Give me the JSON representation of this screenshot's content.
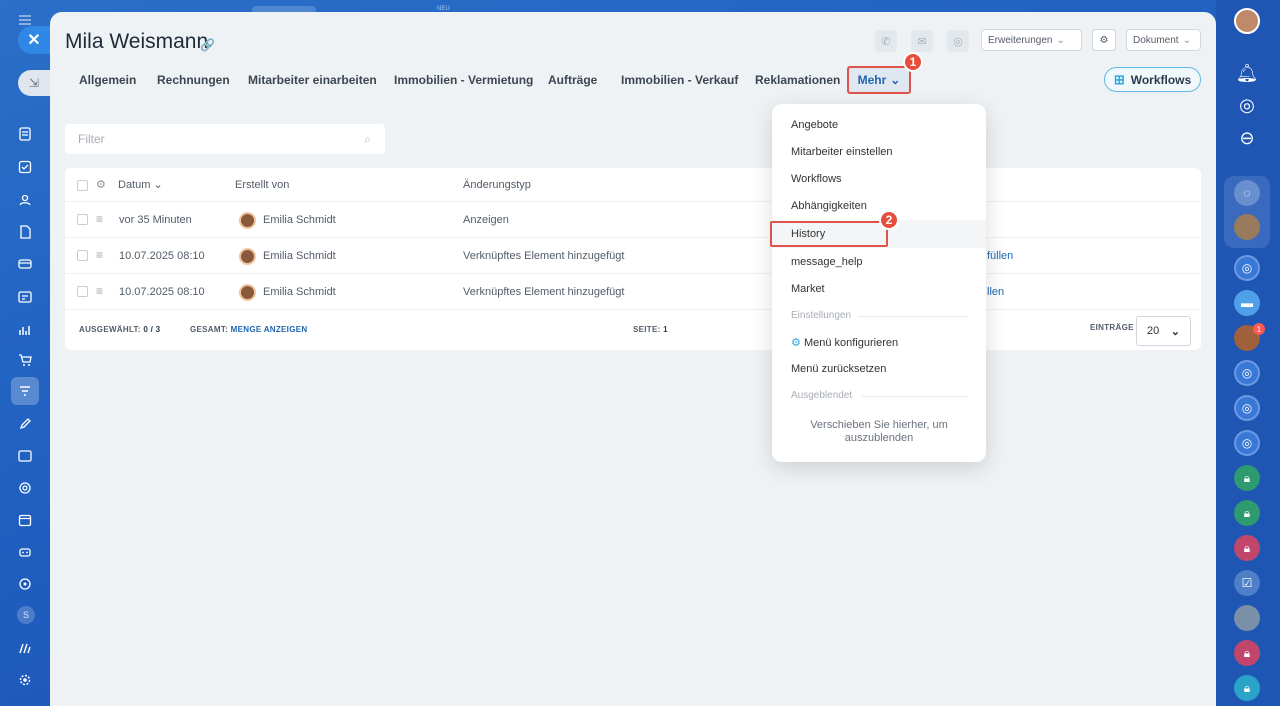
{
  "left_sidebar": {
    "close_symbol": "✕",
    "collapse_symbol": "⇲",
    "badge": "S",
    "icons": [
      "home-icon",
      "document-icon",
      "task-icon",
      "contacts-icon",
      "file-icon",
      "card-icon",
      "id-icon",
      "chart-icon",
      "cart-icon",
      "funnel-icon",
      "edit-icon",
      "image-icon",
      "support-icon",
      "calendar-icon",
      "bot-icon",
      "target-icon",
      "signal-icon",
      "settings-icon"
    ]
  },
  "top_badge": "NEU",
  "header": {
    "title": "Mila Weismann",
    "extensions_label": "Erweiterungen",
    "document_label": "Dokument"
  },
  "tabs": [
    {
      "label": "Allgemein"
    },
    {
      "label": "Rechnungen"
    },
    {
      "label": "Mitarbeiter einarbeiten"
    },
    {
      "label": "Immobilien - Vermietung"
    },
    {
      "label": "Aufträge"
    },
    {
      "label": "Immobilien - Verkauf"
    },
    {
      "label": "Reklamationen"
    }
  ],
  "more_tab": {
    "label": "Mehr",
    "callout": "1"
  },
  "workflows_button": {
    "label": "Workflows"
  },
  "filter": {
    "placeholder": "Filter"
  },
  "table": {
    "headers": {
      "date": "Datum",
      "created_by": "Erstellt von",
      "change_type": "Änderungstyp"
    },
    "rows": [
      {
        "date": "vor 35 Minuten",
        "user": "Emilia Schmidt",
        "change": "Anzeigen",
        "extra": ""
      },
      {
        "date": "10.07.2025 08:10",
        "user": "Emilia Schmidt",
        "change": "Verknüpftes Element hinzugefügt",
        "extra": "füllen"
      },
      {
        "date": "10.07.2025 08:10",
        "user": "Emilia Schmidt",
        "change": "Verknüpftes Element hinzugefügt",
        "extra": "llen"
      }
    ],
    "footer": {
      "selected_label": "AUSGEWÄHLT:",
      "selected_value": "0 / 3",
      "total_label": "GESAMT:",
      "total_link": "MENGE ANZEIGEN",
      "page_label": "SEITE:",
      "page_value": "1",
      "entries_label": "EINTRÄGE",
      "entries_value": "20"
    }
  },
  "menu": {
    "items": [
      "Angebote",
      "Mitarbeiter einstellen",
      "Workflows",
      "Abhängigkeiten",
      "History",
      "message_help",
      "Market"
    ],
    "history_callout": "2",
    "settings_section": "Einstellungen",
    "configure_label": "Menü konfigurieren",
    "reset_label": "Menü zurücksetzen",
    "hidden_section": "Ausgeblendet",
    "hint_line1": "Verschieben Sie hierher, um",
    "hint_line2": "auszublenden"
  },
  "right_sidebar": {
    "notification_count": "1"
  },
  "colors": {
    "accent": "#2066b0",
    "callout": "#e74c3c",
    "background": "#1f5fc0"
  }
}
